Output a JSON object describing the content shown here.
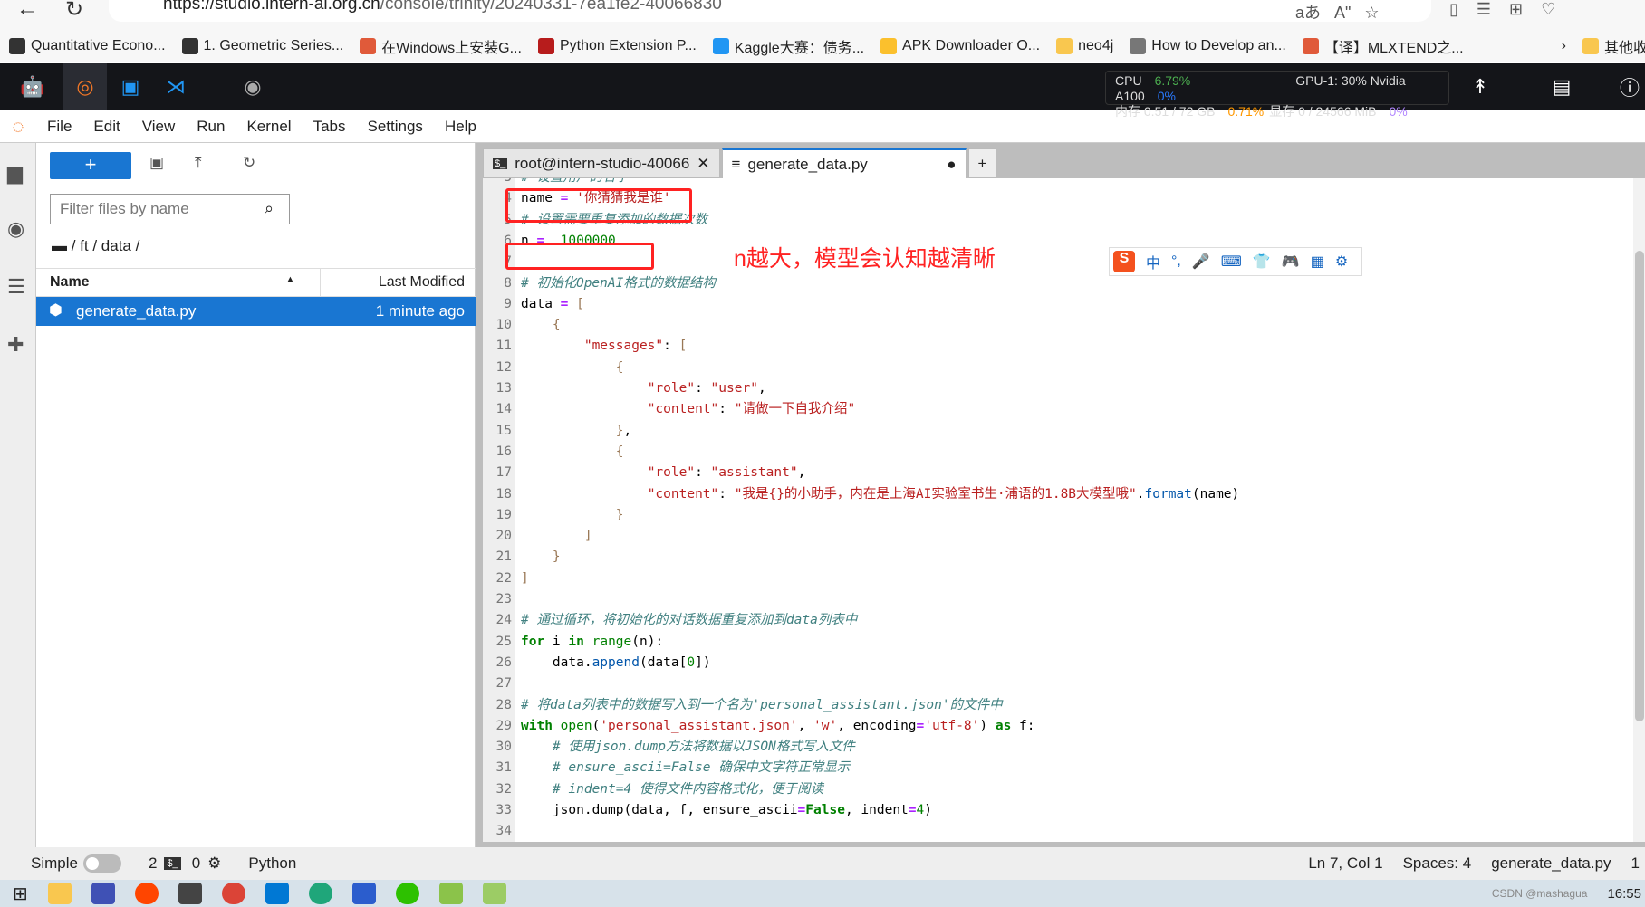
{
  "browser": {
    "url_host": "https://studio.intern-ai.org.cn",
    "url_path": "/console/trinity/20240331-7ea1fe2-40066830",
    "back_icon": "arrow-left-icon",
    "refresh_icon": "refresh-icon"
  },
  "bookmarks": [
    {
      "label": "Quantitative Econo...",
      "color": "#333"
    },
    {
      "label": "1. Geometric Series...",
      "color": "#333"
    },
    {
      "label": "在Windows上安装G...",
      "color": "#e05a3a"
    },
    {
      "label": "Python Extension P...",
      "color": "#b71c1c"
    },
    {
      "label": "Kaggle大赛：债务...",
      "color": "#2196f3"
    },
    {
      "label": "APK Downloader O...",
      "color": "#fbc02d"
    },
    {
      "label": "neo4j",
      "color": "#f9c74f"
    },
    {
      "label": "How to Develop an...",
      "color": "#777"
    },
    {
      "label": "【译】MLXTEND之...",
      "color": "#e05a3a"
    },
    {
      "label": "其他收藏",
      "color": "#f9c74f"
    }
  ],
  "resources": {
    "cpu_label": "CPU",
    "cpu": "6.79%",
    "mem_label": "内存 0.51 / 72 GB",
    "mem": "0.71%",
    "gpu_label": "GPU-1: 30% Nvidia A100",
    "gpu": "0%",
    "vram_label": "显存 0 / 24566 MiB",
    "vram": "0%",
    "colors": {
      "cpu": "#4caf50",
      "mem": "#ff9800",
      "gpu": "#2979ff",
      "vram": "#b388ff"
    }
  },
  "menu": [
    "File",
    "Edit",
    "View",
    "Run",
    "Kernel",
    "Tabs",
    "Settings",
    "Help"
  ],
  "filebrowser": {
    "new_label": "+",
    "filter_placeholder": "Filter files by name",
    "breadcrumb": "/ ft / data /",
    "col_name": "Name",
    "col_modified": "Last Modified",
    "files": [
      {
        "name": "generate_data.py",
        "modified": "1 minute ago"
      }
    ]
  },
  "tabs": [
    {
      "label": "root@intern-studio-40066",
      "icon": "terminal-icon"
    },
    {
      "label": "generate_data.py",
      "icon": "file-text-icon"
    }
  ],
  "code": [
    [
      3,
      [
        [
          "cm",
          "# 设置用户的名字"
        ]
      ]
    ],
    [
      4,
      [
        [
          "tx",
          "name "
        ],
        [
          "op",
          "="
        ],
        [
          "tx",
          " "
        ],
        [
          "st",
          "'你猜猜我是谁'"
        ]
      ]
    ],
    [
      5,
      [
        [
          "cm",
          "# 设置需要重复添加的数据次数"
        ]
      ]
    ],
    [
      6,
      [
        [
          "tx",
          "n "
        ],
        [
          "op",
          "="
        ],
        [
          "tx",
          "  "
        ],
        [
          "nu",
          "1000000"
        ]
      ]
    ],
    [
      7,
      []
    ],
    [
      8,
      [
        [
          "cm",
          "# 初始化OpenAI格式的数据结构"
        ]
      ]
    ],
    [
      9,
      [
        [
          "tx",
          "data "
        ],
        [
          "op",
          "="
        ],
        [
          "tx",
          " "
        ],
        [
          "br",
          "["
        ]
      ]
    ],
    [
      10,
      [
        [
          "tx",
          "    "
        ],
        [
          "br",
          "{"
        ]
      ]
    ],
    [
      11,
      [
        [
          "tx",
          "        "
        ],
        [
          "st",
          "\"messages\""
        ],
        [
          "tx",
          ": "
        ],
        [
          "br",
          "["
        ]
      ]
    ],
    [
      12,
      [
        [
          "tx",
          "            "
        ],
        [
          "br",
          "{"
        ]
      ]
    ],
    [
      13,
      [
        [
          "tx",
          "                "
        ],
        [
          "st",
          "\"role\""
        ],
        [
          "tx",
          ": "
        ],
        [
          "st",
          "\"user\""
        ],
        [
          "tx",
          ","
        ]
      ]
    ],
    [
      14,
      [
        [
          "tx",
          "                "
        ],
        [
          "st",
          "\"content\""
        ],
        [
          "tx",
          ": "
        ],
        [
          "st",
          "\"请做一下自我介绍\""
        ]
      ]
    ],
    [
      15,
      [
        [
          "tx",
          "            "
        ],
        [
          "br",
          "}"
        ],
        [
          "tx",
          ","
        ]
      ]
    ],
    [
      16,
      [
        [
          "tx",
          "            "
        ],
        [
          "br",
          "{"
        ]
      ]
    ],
    [
      17,
      [
        [
          "tx",
          "                "
        ],
        [
          "st",
          "\"role\""
        ],
        [
          "tx",
          ": "
        ],
        [
          "st",
          "\"assistant\""
        ],
        [
          "tx",
          ","
        ]
      ]
    ],
    [
      18,
      [
        [
          "tx",
          "                "
        ],
        [
          "st",
          "\"content\""
        ],
        [
          "tx",
          ": "
        ],
        [
          "st",
          "\"我是{}的小助手，内在是上海AI实验室书生·浦语的1.8B大模型哦\""
        ],
        [
          "tx",
          "."
        ],
        [
          "fn",
          "format"
        ],
        [
          "tx",
          "(name)"
        ]
      ]
    ],
    [
      19,
      [
        [
          "tx",
          "            "
        ],
        [
          "br",
          "}"
        ]
      ]
    ],
    [
      20,
      [
        [
          "tx",
          "        "
        ],
        [
          "br",
          "]"
        ]
      ]
    ],
    [
      21,
      [
        [
          "tx",
          "    "
        ],
        [
          "br",
          "}"
        ]
      ]
    ],
    [
      22,
      [
        [
          "br",
          "]"
        ]
      ]
    ],
    [
      23,
      []
    ],
    [
      24,
      [
        [
          "cm",
          "# 通过循环，将初始化的对话数据重复添加到data列表中"
        ]
      ]
    ],
    [
      25,
      [
        [
          "kw",
          "for"
        ],
        [
          "tx",
          " i "
        ],
        [
          "kw",
          "in"
        ],
        [
          "tx",
          " "
        ],
        [
          "bi",
          "range"
        ],
        [
          "tx",
          "(n):"
        ]
      ]
    ],
    [
      26,
      [
        [
          "tx",
          "    data."
        ],
        [
          "fn",
          "append"
        ],
        [
          "tx",
          "(data["
        ],
        [
          "nu",
          "0"
        ],
        [
          "tx",
          "])"
        ]
      ]
    ],
    [
      27,
      []
    ],
    [
      28,
      [
        [
          "cm",
          "# 将data列表中的数据写入到一个名为'personal_assistant.json'的文件中"
        ]
      ]
    ],
    [
      29,
      [
        [
          "kw",
          "with"
        ],
        [
          "tx",
          " "
        ],
        [
          "bi",
          "open"
        ],
        [
          "tx",
          "("
        ],
        [
          "st",
          "'personal_assistant.json'"
        ],
        [
          "tx",
          ", "
        ],
        [
          "st",
          "'w'"
        ],
        [
          "tx",
          ", encoding"
        ],
        [
          "op",
          "="
        ],
        [
          "st",
          "'utf-8'"
        ],
        [
          "tx",
          ") "
        ],
        [
          "kw",
          "as"
        ],
        [
          "tx",
          " f:"
        ]
      ]
    ],
    [
      30,
      [
        [
          "tx",
          "    "
        ],
        [
          "cm",
          "# 使用json.dump方法将数据以JSON格式写入文件"
        ]
      ]
    ],
    [
      31,
      [
        [
          "tx",
          "    "
        ],
        [
          "cm",
          "# ensure_ascii=False 确保中文字符正常显示"
        ]
      ]
    ],
    [
      32,
      [
        [
          "tx",
          "    "
        ],
        [
          "cm",
          "# indent=4 使得文件内容格式化，便于阅读"
        ]
      ]
    ],
    [
      33,
      [
        [
          "tx",
          "    json.dump(data, f, ensure_ascii"
        ],
        [
          "op",
          "="
        ],
        [
          "kw",
          "False"
        ],
        [
          "tx",
          ", indent"
        ],
        [
          "op",
          "="
        ],
        [
          "nu",
          "4"
        ],
        [
          "tx",
          ")"
        ]
      ]
    ],
    [
      34,
      []
    ]
  ],
  "annotation": "n越大，模型会认知越清晰",
  "ime": {
    "items": [
      "中",
      "°,",
      "🎤",
      "⌨",
      "👕",
      "🎮",
      "▦",
      "⚙"
    ]
  },
  "status": {
    "mode": "Simple",
    "terminals": "2",
    "kernels": "0",
    "language": "Python",
    "position": "Ln 7, Col 1",
    "spaces": "Spaces: 4",
    "filename": "generate_data.py",
    "extra": "1"
  },
  "taskbar": {
    "time": "16:55",
    "watermark": "CSDN @mashagua"
  }
}
